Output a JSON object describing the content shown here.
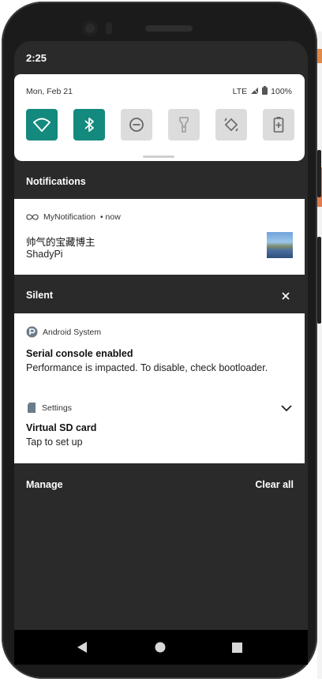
{
  "status_bar": {
    "time": "2:25"
  },
  "quick_settings": {
    "date": "Mon, Feb 21",
    "network": "LTE",
    "battery": "100%",
    "tiles": [
      {
        "name": "wifi",
        "active": true
      },
      {
        "name": "bluetooth",
        "active": true
      },
      {
        "name": "do-not-disturb",
        "active": false
      },
      {
        "name": "flashlight",
        "active": false
      },
      {
        "name": "auto-rotate",
        "active": false
      },
      {
        "name": "battery-saver",
        "active": false
      }
    ]
  },
  "notifications": {
    "header": "Notifications",
    "items": [
      {
        "app": "MyNotification",
        "time": "• now",
        "title": "帅气的宝藏博主",
        "text": "ShadyPi"
      }
    ]
  },
  "silent": {
    "header": "Silent",
    "items": [
      {
        "app": "Android System",
        "title": "Serial console enabled",
        "text": "Performance is impacted. To disable, check bootloader."
      },
      {
        "app": "Settings",
        "title": "Virtual SD card",
        "text": "Tap to set up"
      }
    ]
  },
  "footer": {
    "manage": "Manage",
    "clear_all": "Clear all"
  },
  "colors": {
    "accent": "#138a7d",
    "shade_bg": "#2a2a2a",
    "tile_off": "#dcdcdc"
  }
}
